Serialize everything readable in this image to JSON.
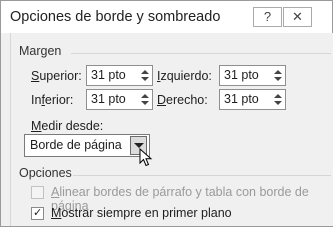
{
  "dialog": {
    "title": "Opciones de borde y sombreado",
    "help_label": "?",
    "close_label": "✕"
  },
  "margin": {
    "section_title": "Margen",
    "top": {
      "label_u": "S",
      "label_rest": "uperior:",
      "value": "31 pto"
    },
    "left": {
      "label_u": "I",
      "label_rest": "zquierdo:",
      "value": "31 pto"
    },
    "bottom": {
      "label_pre": "In",
      "label_u": "f",
      "label_rest": "erior:",
      "value": "31 pto"
    },
    "right": {
      "label_u": "D",
      "label_rest": "erecho:",
      "value": "31 pto"
    },
    "measure_from": {
      "label_u": "M",
      "label_rest": "edir desde:",
      "value": "Borde de página"
    }
  },
  "options": {
    "section_title": "Opciones",
    "align_borders": {
      "label_u": "A",
      "label_rest": "linear bordes de párrafo y tabla con borde de página",
      "checked": false,
      "enabled": false
    },
    "always_front": {
      "label_u": "M",
      "label_rest": "ostrar siempre en primer plano",
      "checked": true,
      "enabled": true
    }
  }
}
